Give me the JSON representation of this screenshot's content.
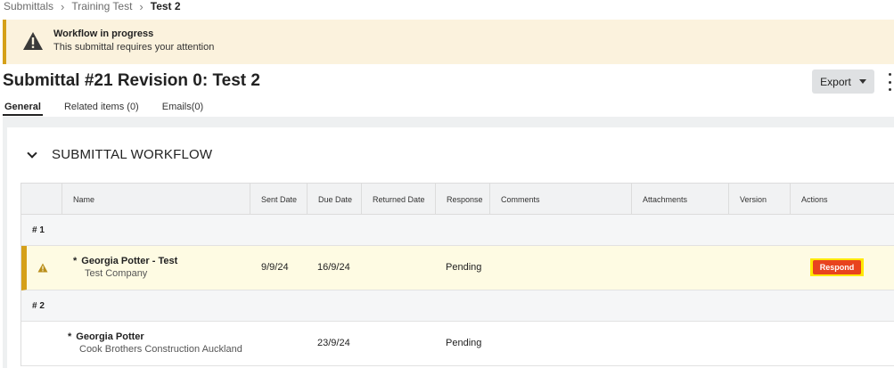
{
  "breadcrumb": {
    "items": [
      "Submittals",
      "Training Test"
    ],
    "current": "Test 2"
  },
  "banner": {
    "title": "Workflow in progress",
    "subtitle": "This submittal requires your attention"
  },
  "header": {
    "title": "Submittal #21 Revision 0: Test 2",
    "export_label": "Export"
  },
  "tabs": [
    {
      "label": "General",
      "active": true
    },
    {
      "label": "Related items (0)",
      "active": false
    },
    {
      "label": "Emails(0)",
      "active": false
    }
  ],
  "section": {
    "title": "SUBMITTAL WORKFLOW"
  },
  "table": {
    "columns": [
      "Name",
      "Sent Date",
      "Due Date",
      "Returned Date",
      "Response",
      "Comments",
      "Attachments",
      "Version",
      "Actions"
    ],
    "groups": [
      {
        "label": "# 1",
        "rows": [
          {
            "name": "Georgia Potter - Test",
            "company": "Test Company",
            "sent": "9/9/24",
            "due": "16/9/24",
            "returned": "",
            "response": "Pending",
            "action": "Respond"
          }
        ]
      },
      {
        "label": "# 2",
        "rows": [
          {
            "name": "Georgia Potter",
            "company": "Cook Brothers Construction Auckland",
            "sent": "",
            "due": "23/9/24",
            "returned": "",
            "response": "Pending",
            "action": ""
          }
        ]
      }
    ]
  },
  "colors": {
    "warning": "#d5a019",
    "banner_bg": "#fbf2dd",
    "respond_bg": "#e8431e",
    "highlight": "#ffe800"
  },
  "icons": {
    "banner": "warning-icon",
    "row": "warning-icon",
    "breadcrumb_sep": "chevron-right-icon",
    "section": "chevron-down-icon",
    "menu": "kebab-menu-icon"
  }
}
